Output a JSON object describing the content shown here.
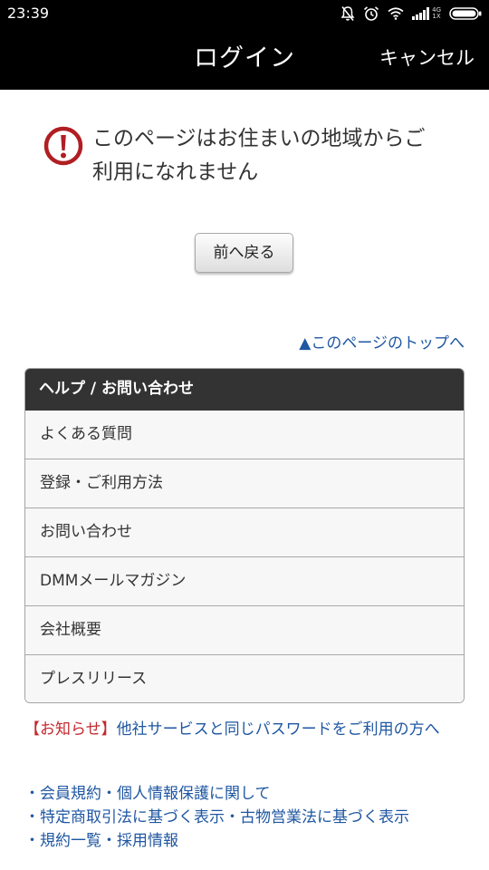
{
  "status_bar": {
    "time": "23:39",
    "network_top": "4G",
    "network_bottom": "1X",
    "icons": [
      "mute-icon",
      "alarm-icon",
      "wifi-icon",
      "signal-icon",
      "battery-icon"
    ]
  },
  "nav": {
    "title": "ログイン",
    "cancel_label": "キャンセル"
  },
  "error": {
    "icon": "exclamation-circle-icon",
    "message_line1": "このページはお住まいの地域からご",
    "message_line2": "利用になれません"
  },
  "back_button": {
    "label": "前へ戻る"
  },
  "page_top_link": {
    "label": "▲このページのトップへ"
  },
  "help": {
    "header": "ヘルプ / お問い合わせ",
    "items": [
      {
        "label": "よくある質問"
      },
      {
        "label": "登録・ご利用方法"
      },
      {
        "label": "お問い合わせ"
      },
      {
        "label": "DMMメールマガジン"
      },
      {
        "label": "会社概要"
      },
      {
        "label": "プレスリリース"
      }
    ]
  },
  "notice": {
    "tag": "【お知らせ】",
    "text": "他社サービスと同じパスワードをご利用の方へ"
  },
  "footer": {
    "bullet": "・",
    "separator": "・",
    "rows": [
      [
        "会員規約",
        "個人情報保護に関して"
      ],
      [
        "特定商取引法に基づく表示",
        "古物営業法に基づく表示"
      ],
      [
        "規約一覧",
        "採用情報"
      ]
    ]
  },
  "colors": {
    "link": "#1f57a2",
    "notice_tag": "#c3282d",
    "error_icon": "#b01e23",
    "header_bg": "#333333"
  }
}
